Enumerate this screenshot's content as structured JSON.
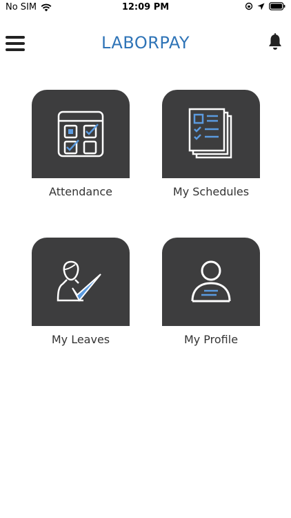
{
  "status_bar": {
    "carrier": "No SIM",
    "time": "12:09 PM"
  },
  "header": {
    "title": "LABORPAY"
  },
  "tiles": [
    {
      "label": "Attendance",
      "icon": "attendance-calendar-icon"
    },
    {
      "label": "My Schedules",
      "icon": "schedules-document-icon"
    },
    {
      "label": "My Leaves",
      "icon": "leave-person-check-icon"
    },
    {
      "label": "My Profile",
      "icon": "profile-person-icon"
    }
  ],
  "colors": {
    "brand": "#2f74b7",
    "tile_bg": "#3d3d3e",
    "icon_accent": "#5b9be0"
  }
}
